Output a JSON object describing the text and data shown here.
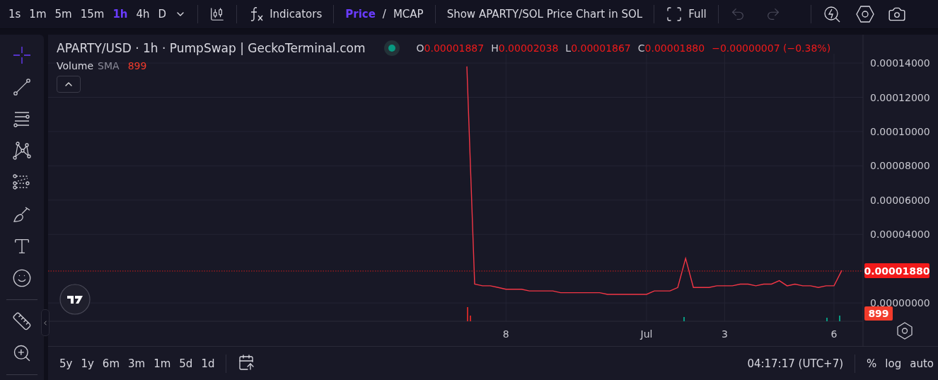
{
  "toolbar": {
    "intervals": [
      {
        "label": "1s",
        "selected": false
      },
      {
        "label": "1m",
        "selected": false
      },
      {
        "label": "5m",
        "selected": false
      },
      {
        "label": "15m",
        "selected": false
      },
      {
        "label": "1h",
        "selected": true
      },
      {
        "label": "4h",
        "selected": false
      },
      {
        "label": "D",
        "selected": false
      }
    ],
    "indicators": "Indicators",
    "price_toggle": [
      {
        "label": "Price",
        "selected": true
      },
      {
        "label": "MCAP",
        "selected": false
      }
    ],
    "toggle_separator": "/",
    "sol_link": "Show APARTY/SOL Price Chart in SOL",
    "full": "Full",
    "undo": {
      "disabled": true
    },
    "redo": {
      "disabled": true
    }
  },
  "tools": [
    {
      "kind": "crosshair",
      "selected": true
    },
    {
      "kind": "trend-line",
      "selected": false
    },
    {
      "kind": "parallel-lines",
      "selected": false
    },
    {
      "kind": "pattern",
      "selected": false
    },
    {
      "kind": "forecast",
      "selected": false
    },
    {
      "kind": "brush",
      "selected": false
    },
    {
      "kind": "text",
      "selected": false
    },
    {
      "kind": "emoji",
      "selected": false
    },
    {
      "kind": "ruler",
      "selected": false
    },
    {
      "kind": "zoom",
      "selected": false
    }
  ],
  "legend": {
    "title": "APARTY/USD · 1h · PumpSwap | GeckoTerminal.com",
    "ohlc": [
      {
        "key": "O",
        "value": "0.00001887"
      },
      {
        "key": "H",
        "value": "0.00002038"
      },
      {
        "key": "L",
        "value": "0.00001867"
      },
      {
        "key": "C",
        "value": "0.00001880"
      }
    ],
    "change": "−0.00000007 (−0.38%)"
  },
  "volume_legend": {
    "name": "Volume",
    "sma": "SMA",
    "value": "899"
  },
  "chart": {
    "last_price": "0.00001880",
    "last_volume": "899",
    "chart_data": {
      "type": "line",
      "grid": true,
      "ylim": [
        -1.07e-05,
        0.0001454
      ],
      "yticks": [
        {
          "value": 0.00014,
          "label": "0.00014000"
        },
        {
          "value": 0.00012,
          "label": "0.00012000"
        },
        {
          "value": 0.0001,
          "label": "0.00010000"
        },
        {
          "value": 8e-05,
          "label": "0.00008000"
        },
        {
          "value": 6e-05,
          "label": "0.00006000"
        },
        {
          "value": 4e-05,
          "label": "0.00004000"
        },
        {
          "value": 0,
          "label": "0.00000000"
        }
      ],
      "categories": [
        null,
        null,
        null,
        null,
        null,
        "8",
        null,
        null,
        null,
        null,
        null,
        null,
        null,
        null,
        null,
        null,
        null,
        null,
        null,
        null,
        null,
        null,
        null,
        "Jul",
        null,
        null,
        null,
        null,
        null,
        null,
        null,
        null,
        null,
        "3",
        null,
        null,
        null,
        null,
        null,
        null,
        null,
        null,
        null,
        null,
        null,
        null,
        null,
        "6",
        null
      ],
      "series": [
        {
          "color": "#f23645",
          "values": [
            0.000138,
            1.1e-05,
            1e-05,
            1e-05,
            9e-06,
            8e-06,
            8e-06,
            8e-06,
            7e-06,
            7e-06,
            7e-06,
            7e-06,
            6e-06,
            6e-06,
            6e-06,
            6e-06,
            6e-06,
            6e-06,
            5e-06,
            5e-06,
            5e-06,
            5e-06,
            5e-06,
            5e-06,
            7e-06,
            7e-06,
            7e-06,
            9e-06,
            2.6e-05,
            9e-06,
            9e-06,
            9e-06,
            1e-05,
            1e-05,
            1e-05,
            1.1e-05,
            1.1e-05,
            1e-05,
            1.1e-05,
            1.1e-05,
            1.3e-05,
            1e-05,
            1.1e-05,
            1e-05,
            1e-05,
            9e-06,
            1e-05,
            1e-05,
            1.9e-05
          ]
        }
      ]
    }
  },
  "bottom_bar": {
    "ranges": [
      "5y",
      "1y",
      "6m",
      "3m",
      "1m",
      "5d",
      "1d"
    ],
    "clock": "04:17:17 (UTC+7)",
    "scale_options": [
      "%",
      "log",
      "auto"
    ]
  }
}
